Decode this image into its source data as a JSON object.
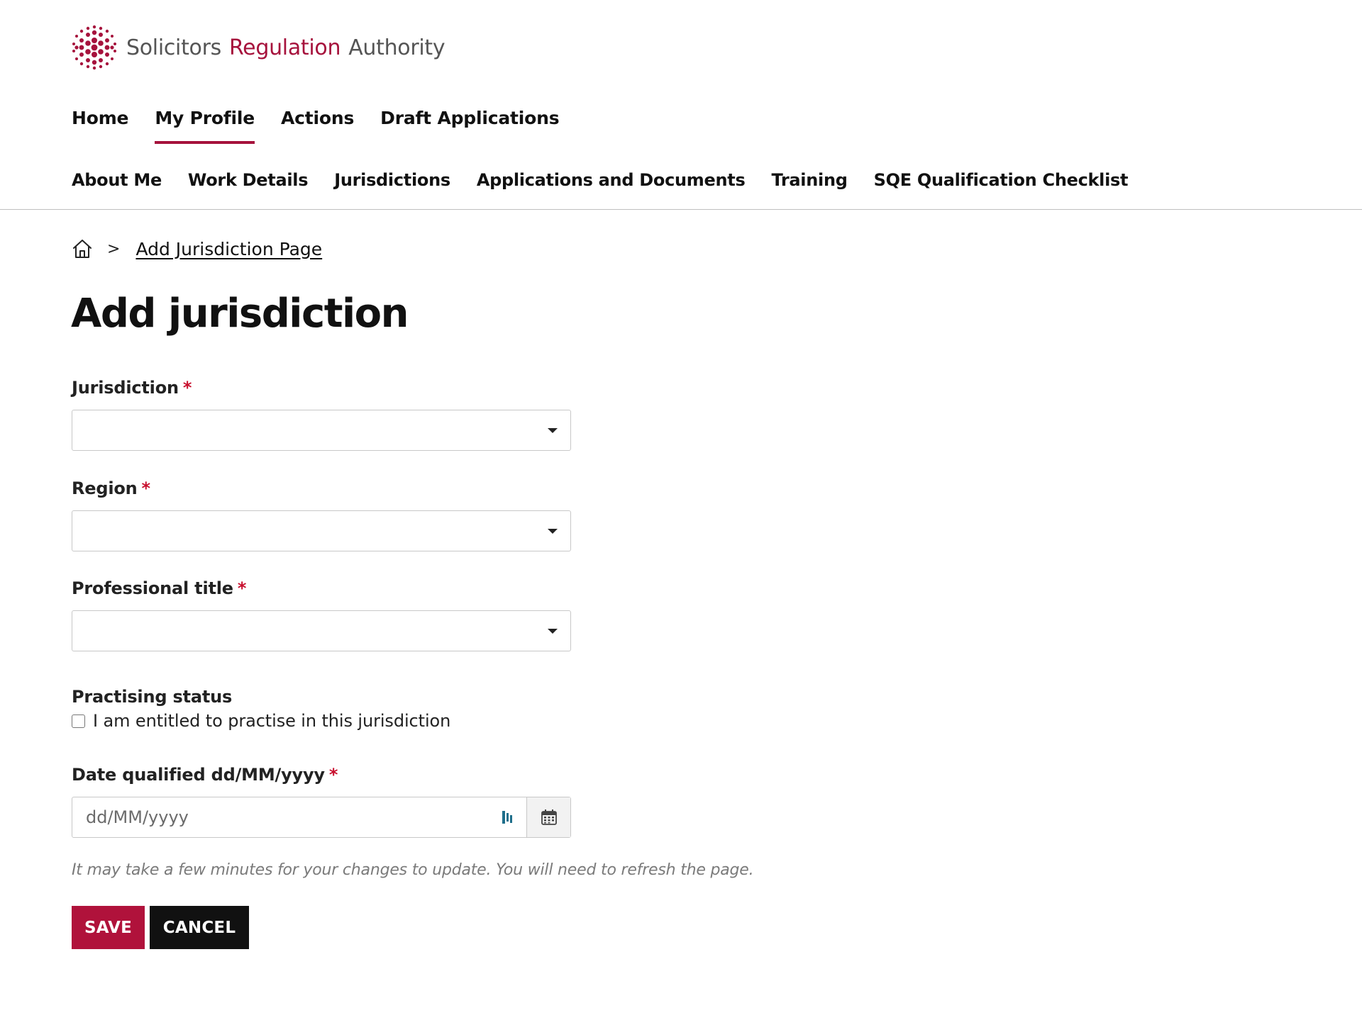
{
  "header": {
    "logo_word_1": "Solicitors",
    "logo_word_2": "Regulation",
    "logo_word_3": "Authority",
    "logo_icon": "srs-dot-logo"
  },
  "primary_nav": {
    "items": [
      {
        "label": "Home",
        "active": false
      },
      {
        "label": "My Profile",
        "active": true
      },
      {
        "label": "Actions",
        "active": false
      },
      {
        "label": "Draft Applications",
        "active": false
      }
    ]
  },
  "secondary_nav": {
    "items": [
      {
        "label": "About Me"
      },
      {
        "label": "Work Details"
      },
      {
        "label": "Jurisdictions"
      },
      {
        "label": "Applications and Documents"
      },
      {
        "label": "Training"
      },
      {
        "label": "SQE Qualification Checklist"
      }
    ]
  },
  "breadcrumb": {
    "home_icon": "home-icon",
    "separator": ">",
    "current": "Add Jurisdiction Page"
  },
  "page": {
    "title": "Add jurisdiction"
  },
  "form": {
    "required_marker": "*",
    "jurisdiction": {
      "label": "Jurisdiction",
      "value": ""
    },
    "region": {
      "label": "Region",
      "value": ""
    },
    "professional_title": {
      "label": "Professional title",
      "value": ""
    },
    "practising_status": {
      "label": "Practising status",
      "checkbox_label": "I am entitled to practise in this jurisdiction",
      "checked": false
    },
    "date_qualified": {
      "label": "Date qualified dd/MM/yyyy",
      "placeholder": "dd/MM/yyyy",
      "value": ""
    },
    "help_note": "It may take a few minutes for your changes to update. You will need to refresh the page.",
    "save_label": "SAVE",
    "cancel_label": "CANCEL"
  },
  "colors": {
    "brand": "#a6123c",
    "save_button": "#b0123b",
    "cancel_button": "#111111",
    "required": "#c8102e",
    "autofill_icon": "#1f6f8b"
  }
}
